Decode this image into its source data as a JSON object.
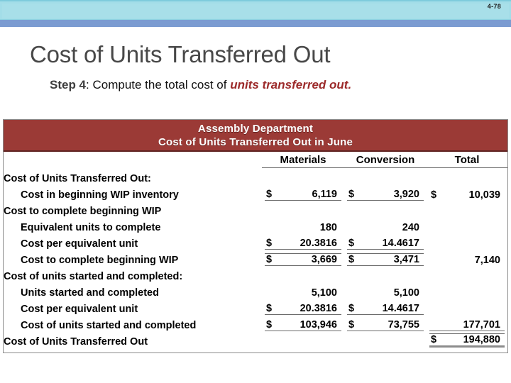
{
  "slide": {
    "number": "4-78",
    "title": "Cost of Units Transferred Out",
    "subtitle": {
      "lead": "Step 4",
      "middle": ": Compute the total cost of ",
      "emphasis": "units transferred out."
    }
  },
  "colors": {
    "banner_red": "#9B3A36",
    "band_cyan": "#A3DDE8",
    "band_blue": "#7B9BD1",
    "emphasis_red": "#9C2A2A",
    "title_gray": "#484848"
  },
  "exhibit": {
    "banner_line1": "Assembly Department",
    "banner_line2": "Cost of Units Transferred Out in June",
    "columns": [
      "Materials",
      "Conversion",
      "Total"
    ],
    "rows": [
      {
        "type": "section",
        "label": "Cost of Units Transferred Out:",
        "materials": "",
        "conversion": "",
        "total": ""
      },
      {
        "type": "data",
        "indent": true,
        "label": "Cost in beginning WIP inventory",
        "materials_cur": "$",
        "materials": "6,119",
        "conversion_cur": "$",
        "conversion": "3,920",
        "total_cur": "$",
        "total": "10,039",
        "rule": "under-mat-conv"
      },
      {
        "type": "section",
        "label": "Cost to complete beginning WIP",
        "materials": "",
        "conversion": "",
        "total": ""
      },
      {
        "type": "data",
        "indent": true,
        "label": "Equivalent units to complete",
        "materials_cur": "",
        "materials": "180",
        "conversion_cur": "",
        "conversion": "240",
        "total_cur": "",
        "total": ""
      },
      {
        "type": "data",
        "indent": true,
        "label": "Cost per equivalent unit",
        "materials_cur": "$",
        "materials": "20.3816",
        "conversion_cur": "$",
        "conversion": "14.4617",
        "total_cur": "",
        "total": "",
        "rule": "under-mat-conv"
      },
      {
        "type": "data",
        "indent": true,
        "label": "Cost to complete beginning WIP",
        "materials_cur": "$",
        "materials": "3,669",
        "conversion_cur": "$",
        "conversion": "3,471",
        "total_cur": "",
        "total": "7,140",
        "rule": "under-mat-conv"
      },
      {
        "type": "section",
        "label": "Cost of units started and completed:",
        "materials": "",
        "conversion": "",
        "total": ""
      },
      {
        "type": "data",
        "indent": true,
        "label": "Units started and completed",
        "materials_cur": "",
        "materials": "5,100",
        "conversion_cur": "",
        "conversion": "5,100",
        "total_cur": "",
        "total": ""
      },
      {
        "type": "data",
        "indent": true,
        "label": "Cost per equivalent unit",
        "materials_cur": "$",
        "materials": "20.3816",
        "conversion_cur": "$",
        "conversion": "14.4617",
        "total_cur": "",
        "total": "",
        "rule": "under-mat-conv"
      },
      {
        "type": "data",
        "indent": true,
        "label": "Cost of units started and completed",
        "materials_cur": "$",
        "materials": "103,946",
        "conversion_cur": "$",
        "conversion": "73,755",
        "total_cur": "",
        "total": "177,701",
        "rule": "under-mat-conv-total"
      },
      {
        "type": "total",
        "label": "Cost of Units Transferred Out",
        "materials_cur": "",
        "materials": "",
        "conversion_cur": "",
        "conversion": "",
        "total_cur": "$",
        "total": "194,880",
        "rule": "grand-total"
      }
    ]
  }
}
